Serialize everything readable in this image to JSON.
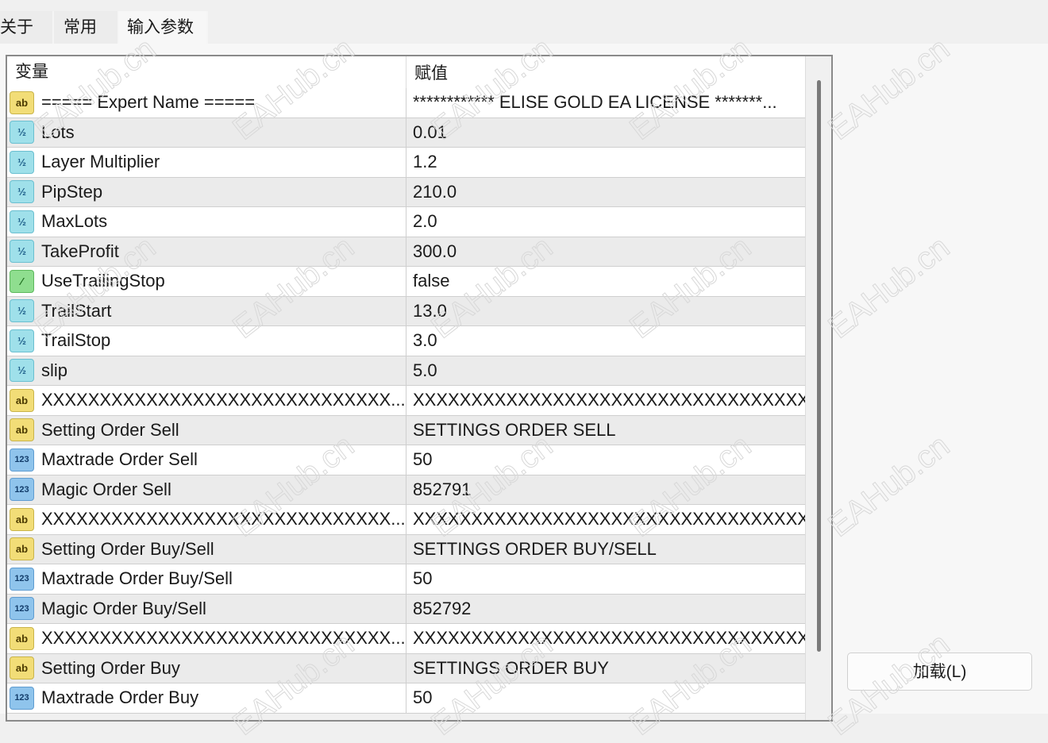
{
  "tabs": [
    "关于",
    "常用",
    "输入参数"
  ],
  "active_tab": "输入参数",
  "table": {
    "headers": [
      "变量",
      "赋值"
    ],
    "rows": [
      {
        "type": "ab",
        "name": "===== Expert Name =====",
        "value": "************ ELISE GOLD EA LICENSE *******..."
      },
      {
        "type": "double",
        "name": "Lots",
        "value": "0.01"
      },
      {
        "type": "double",
        "name": "Layer Multiplier",
        "value": "1.2"
      },
      {
        "type": "double",
        "name": "PipStep",
        "value": "210.0"
      },
      {
        "type": "double",
        "name": "MaxLots",
        "value": "2.0"
      },
      {
        "type": "double",
        "name": "TakeProfit",
        "value": "300.0"
      },
      {
        "type": "bool",
        "name": "UseTrailingStop",
        "value": "false"
      },
      {
        "type": "double",
        "name": "TrailStart",
        "value": "13.0"
      },
      {
        "type": "double",
        "name": "TrailStop",
        "value": "3.0"
      },
      {
        "type": "double",
        "name": "slip",
        "value": "5.0"
      },
      {
        "type": "ab",
        "name": "XXXXXXXXXXXXXXXXXXXXXXXXXXXXXX...",
        "value": "XXXXXXXXXXXXXXXXXXXXXXXXXXXXXXXXXX"
      },
      {
        "type": "ab",
        "name": "Setting Order Sell",
        "value": "SETTINGS ORDER SELL"
      },
      {
        "type": "int",
        "name": "Maxtrade Order Sell",
        "value": "50"
      },
      {
        "type": "int",
        "name": "Magic Order Sell",
        "value": "852791"
      },
      {
        "type": "ab",
        "name": "XXXXXXXXXXXXXXXXXXXXXXXXXXXXXX...",
        "value": "XXXXXXXXXXXXXXXXXXXXXXXXXXXXXXXXXX"
      },
      {
        "type": "ab",
        "name": "Setting Order Buy/Sell",
        "value": "SETTINGS ORDER BUY/SELL"
      },
      {
        "type": "int",
        "name": "Maxtrade Order Buy/Sell",
        "value": "50"
      },
      {
        "type": "int",
        "name": "Magic Order Buy/Sell",
        "value": "852792"
      },
      {
        "type": "ab",
        "name": "XXXXXXXXXXXXXXXXXXXXXXXXXXXXXX...",
        "value": "XXXXXXXXXXXXXXXXXXXXXXXXXXXXXXXXXX"
      },
      {
        "type": "ab",
        "name": "Setting Order Buy",
        "value": "SETTINGS ORDER BUY"
      },
      {
        "type": "int",
        "name": "Maxtrade Order Buy",
        "value": "50"
      }
    ]
  },
  "icon_glyphs": {
    "ab": "ab",
    "double": "½",
    "int": "123",
    "bool": "⁄"
  },
  "load_button": "加载(L)",
  "watermark": "EAHub.cn"
}
